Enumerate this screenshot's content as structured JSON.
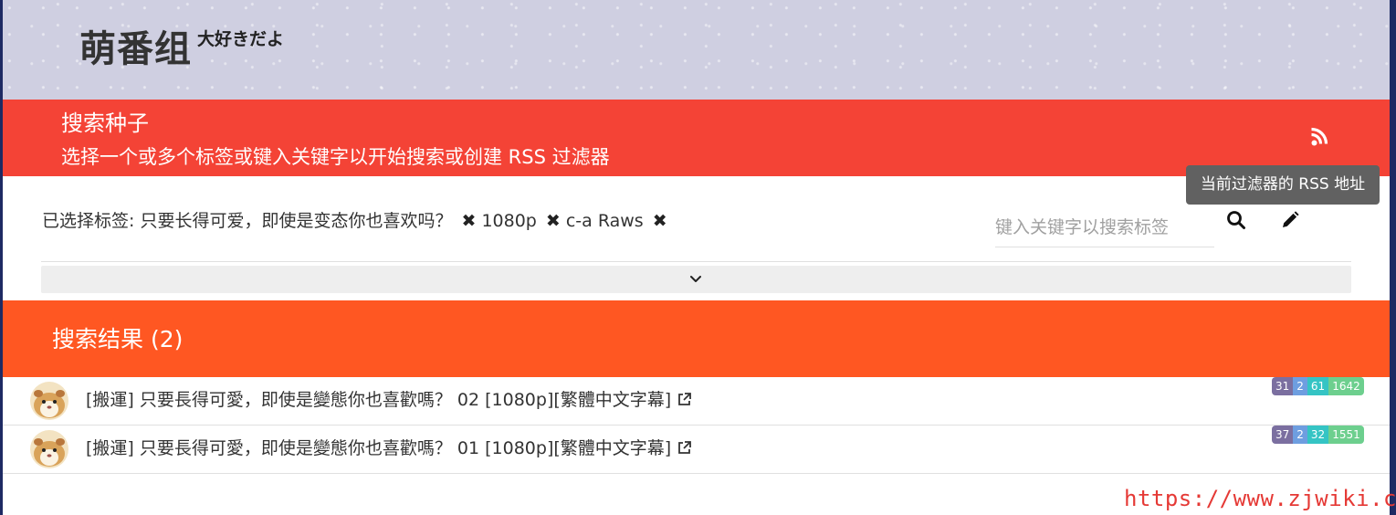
{
  "site": {
    "logo": "萌番组",
    "logo_sub": "大好きだよ"
  },
  "search": {
    "title": "搜索种子",
    "subtitle": "选择一个或多个标签或键入关键字以开始搜索或创建 RSS 过滤器",
    "rss_tooltip": "当前过滤器的 RSS 地址",
    "selected_label": "已选择标签:",
    "tags": [
      "只要长得可爱，即使是变态你也喜欢吗？",
      "1080p",
      "c-a Raws"
    ],
    "keyword_placeholder": "键入关键字以搜索标签"
  },
  "results": {
    "title": "搜索结果 (2)",
    "items": [
      {
        "title": "[搬運] 只要長得可愛，即使是變態你也喜歡嗎？ 02 [1080p][繁體中文字幕]",
        "stats": [
          "31",
          "2",
          "61",
          "1642"
        ]
      },
      {
        "title": "[搬運] 只要長得可愛，即使是變態你也喜歡嗎？ 01 [1080p][繁體中文字幕]",
        "stats": [
          "37",
          "2",
          "32",
          "1551"
        ]
      }
    ]
  },
  "watermark": "https://www.zjwiki.com",
  "colors": {
    "search_header": "#f44336",
    "results_header": "#ff5722",
    "banner": "#cfcfe1"
  },
  "icons": {
    "rss": "rss-icon",
    "search": "search-icon",
    "edit": "pencil-icon",
    "expand": "chevron-down-icon",
    "remove_tag": "close-icon",
    "external": "external-link-icon"
  }
}
